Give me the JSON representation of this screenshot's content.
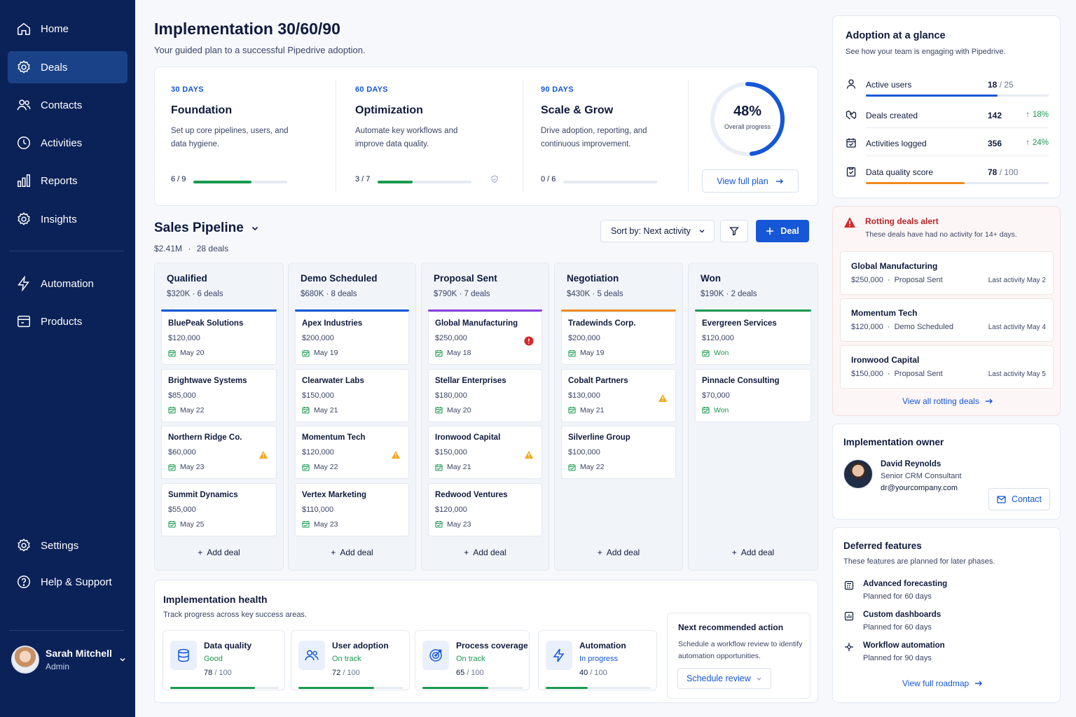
{
  "sidebar": {
    "items": [
      {
        "label": "Home",
        "icon": "home-icon"
      },
      {
        "label": "Deals",
        "icon": "deals-icon",
        "active": true
      },
      {
        "label": "Contacts",
        "icon": "contacts-icon"
      },
      {
        "label": "Activities",
        "icon": "clock-icon"
      },
      {
        "label": "Reports",
        "icon": "bar-chart-icon"
      },
      {
        "label": "Insights",
        "icon": "gear-icon"
      },
      {
        "label": "Automation",
        "icon": "lightning-icon"
      },
      {
        "label": "Products",
        "icon": "box-icon"
      }
    ],
    "bottom_items": [
      {
        "label": "Settings",
        "icon": "gear-icon"
      },
      {
        "label": "Help & Support",
        "icon": "help-icon"
      }
    ],
    "user": {
      "name": "Sarah Mitchell",
      "role": "Admin"
    }
  },
  "header": {
    "title": "Implementation 30/60/90",
    "subtitle": "Your guided plan to a successful Pipedrive adoption."
  },
  "plan": {
    "phases": [
      {
        "label": "30 DAYS",
        "name": "Foundation",
        "desc": "Set up core pipelines, users, and data hygiene.",
        "count": "6 / 9",
        "progress": 0.62
      },
      {
        "label": "60 DAYS",
        "name": "Optimization",
        "desc": "Automate key workflows and improve data quality.",
        "count": "3 / 7",
        "progress": 0.37
      },
      {
        "label": "90 DAYS",
        "name": "Scale & Grow",
        "desc": "Drive adoption, reporting, and continuous improvement.",
        "count": "0 / 6",
        "progress": 0
      }
    ],
    "overall_value": "48%",
    "overall_fraction": 0.48,
    "overall_label": "Overall progress",
    "view_plan_label": "View full plan"
  },
  "pipeline": {
    "title": "Sales Pipeline",
    "summary_value": "$2.41M",
    "summary_deals": "28 deals",
    "sort_label": "Sort by: Next activity",
    "add_deal_button": "Deal",
    "add_deal_link": "Add deal",
    "columns": [
      {
        "name": "Qualified",
        "summary": "$320K · 6 deals",
        "color": "#1557d6",
        "deals": [
          {
            "name": "BluePeak Solutions",
            "value": "$120,000",
            "date": "May 20",
            "flag": ""
          },
          {
            "name": "Brightwave Systems",
            "value": "$85,000",
            "date": "May 22",
            "flag": ""
          },
          {
            "name": "Northern Ridge Co.",
            "value": "$60,000",
            "date": "May 23",
            "flag": "warning"
          },
          {
            "name": "Summit Dynamics",
            "value": "$55,000",
            "date": "May 25",
            "flag": ""
          }
        ]
      },
      {
        "name": "Demo Scheduled",
        "summary": "$680K · 8 deals",
        "color": "#1557d6",
        "deals": [
          {
            "name": "Apex Industries",
            "value": "$200,000",
            "date": "May 19",
            "flag": ""
          },
          {
            "name": "Clearwater Labs",
            "value": "$150,000",
            "date": "May 21",
            "flag": ""
          },
          {
            "name": "Momentum Tech",
            "value": "$120,000",
            "date": "May 22",
            "flag": "warning"
          },
          {
            "name": "Vertex Marketing",
            "value": "$110,000",
            "date": "May 23",
            "flag": ""
          }
        ]
      },
      {
        "name": "Proposal Sent",
        "summary": "$790K · 7 deals",
        "color": "#8a3fe0",
        "deals": [
          {
            "name": "Global Manufacturing",
            "value": "$250,000",
            "date": "May 18",
            "flag": "error"
          },
          {
            "name": "Stellar Enterprises",
            "value": "$180,000",
            "date": "May 20",
            "flag": ""
          },
          {
            "name": "Ironwood Capital",
            "value": "$150,000",
            "date": "May 21",
            "flag": "warning"
          },
          {
            "name": "Redwood Ventures",
            "value": "$120,000",
            "date": "May 23",
            "flag": ""
          }
        ]
      },
      {
        "name": "Negotiation",
        "summary": "$430K · 5 deals",
        "color": "#f08a1c",
        "deals": [
          {
            "name": "Tradewinds Corp.",
            "value": "$200,000",
            "date": "May 19",
            "flag": ""
          },
          {
            "name": "Cobalt Partners",
            "value": "$130,000",
            "date": "May 21",
            "flag": "warning"
          },
          {
            "name": "Silverline Group",
            "value": "$100,000",
            "date": "May 22",
            "flag": ""
          }
        ]
      },
      {
        "name": "Won",
        "summary": "$190K · 2 deals",
        "color": "#1a9a4f",
        "deals": [
          {
            "name": "Evergreen Services",
            "value": "$120,000",
            "date": "Won",
            "flag": ""
          },
          {
            "name": "Pinnacle Consulting",
            "value": "$70,000",
            "date": "Won",
            "flag": ""
          }
        ]
      }
    ]
  },
  "health": {
    "title": "Implementation health",
    "subtitle": "Track progress across key success areas.",
    "items": [
      {
        "name": "Data quality",
        "status": "Good",
        "status_color": "#1a9a4f",
        "score": "78",
        "max": "/ 100",
        "fraction": 0.78,
        "icon": "database-icon"
      },
      {
        "name": "User adoption",
        "status": "On track",
        "status_color": "#1a9a4f",
        "score": "72",
        "max": "/ 100",
        "fraction": 0.72,
        "icon": "users-icon"
      },
      {
        "name": "Process coverage",
        "status": "On track",
        "status_color": "#1a9a4f",
        "score": "65",
        "max": "/ 100",
        "fraction": 0.65,
        "icon": "target-icon"
      },
      {
        "name": "Automation",
        "status": "In progress",
        "status_color": "#1557d6",
        "score": "40",
        "max": "/ 100",
        "fraction": 0.4,
        "icon": "lightning-icon"
      }
    ],
    "next_action": {
      "title": "Next recommended action",
      "desc": "Schedule a workflow review to identify automation opportunities.",
      "button": "Schedule review"
    }
  },
  "adoption": {
    "title": "Adoption at a glance",
    "subtitle": "See how your team is engaging with Pipedrive.",
    "metrics": [
      {
        "label": "Active users",
        "value": "18",
        "suffix": "/ 25",
        "growth": "",
        "fraction": 0.72,
        "color": "#1557d6",
        "icon": "user-icon"
      },
      {
        "label": "Deals created",
        "value": "142",
        "suffix": "",
        "growth": "18%",
        "fraction": null,
        "icon": "handshake-icon"
      },
      {
        "label": "Activities logged",
        "value": "356",
        "suffix": "",
        "growth": "24%",
        "fraction": null,
        "icon": "calendar-check-icon"
      },
      {
        "label": "Data quality score",
        "value": "78",
        "suffix": "/ 100",
        "growth": "",
        "fraction": 0.54,
        "color": "#f08a1c",
        "icon": "clipboard-check-icon"
      }
    ]
  },
  "rotting": {
    "title": "Rotting deals alert",
    "subtitle": "These deals have had no activity for 14+ days.",
    "deals": [
      {
        "name": "Global Manufacturing",
        "value": "$250,000",
        "stage": "Proposal Sent",
        "activity": "Last activity May 2"
      },
      {
        "name": "Momentum Tech",
        "value": "$120,000",
        "stage": "Demo Scheduled",
        "activity": "Last activity May 4"
      },
      {
        "name": "Ironwood Capital",
        "value": "$150,000",
        "stage": "Proposal Sent",
        "activity": "Last activity May 5"
      }
    ],
    "view_all": "View all rotting deals"
  },
  "owner": {
    "title": "Implementation owner",
    "name": "David Reynolds",
    "role": "Senior CRM Consultant",
    "email": "dr@yourcompany.com",
    "contact_label": "Contact"
  },
  "deferred": {
    "title": "Deferred features",
    "subtitle": "These features are planned for later phases.",
    "features": [
      {
        "name": "Advanced forecasting",
        "plan": "Planned for 60 days",
        "icon": "calculator-icon"
      },
      {
        "name": "Custom dashboards",
        "plan": "Planned for 60 days",
        "icon": "dashboard-icon"
      },
      {
        "name": "Workflow automation",
        "plan": "Planned for 90 days",
        "icon": "workflow-icon"
      }
    ],
    "roadmap_link": "View full roadmap"
  }
}
